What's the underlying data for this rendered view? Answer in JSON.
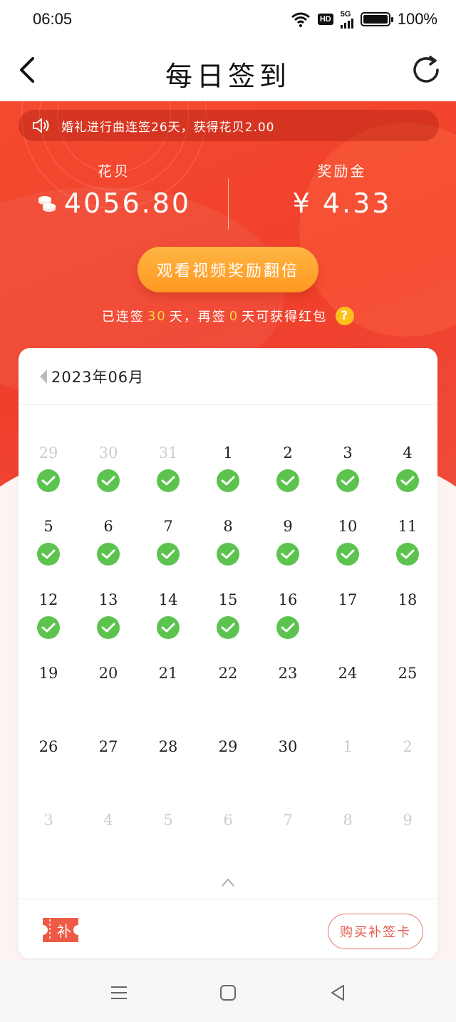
{
  "status_bar": {
    "time": "06:05",
    "hd": "HD",
    "network": "5G",
    "battery": "100%"
  },
  "header": {
    "title": "每日签到"
  },
  "notice": {
    "text": "婚礼进行曲连签26天，获得花贝2.00"
  },
  "stats": {
    "huabei_label": "花贝",
    "huabei_value": "4056.80",
    "reward_label": "奖励金",
    "reward_value": "¥ 4.33"
  },
  "video_button": {
    "label": "观看视频奖励翻倍"
  },
  "streak": {
    "prefix": "已连签",
    "days": "30",
    "mid": "天，再签",
    "remaining": "0",
    "suffix": "天可获得红包",
    "help": "?"
  },
  "calendar": {
    "month_label": "2023年06月",
    "days": [
      {
        "n": "29",
        "muted": true,
        "checked": true
      },
      {
        "n": "30",
        "muted": true,
        "checked": true
      },
      {
        "n": "31",
        "muted": true,
        "checked": true
      },
      {
        "n": "1",
        "muted": false,
        "checked": true
      },
      {
        "n": "2",
        "muted": false,
        "checked": true
      },
      {
        "n": "3",
        "muted": false,
        "checked": true
      },
      {
        "n": "4",
        "muted": false,
        "checked": true
      },
      {
        "n": "5",
        "muted": false,
        "checked": true
      },
      {
        "n": "6",
        "muted": false,
        "checked": true
      },
      {
        "n": "7",
        "muted": false,
        "checked": true
      },
      {
        "n": "8",
        "muted": false,
        "checked": true
      },
      {
        "n": "9",
        "muted": false,
        "checked": true
      },
      {
        "n": "10",
        "muted": false,
        "checked": true
      },
      {
        "n": "11",
        "muted": false,
        "checked": true
      },
      {
        "n": "12",
        "muted": false,
        "checked": true
      },
      {
        "n": "13",
        "muted": false,
        "checked": true
      },
      {
        "n": "14",
        "muted": false,
        "checked": true
      },
      {
        "n": "15",
        "muted": false,
        "checked": true
      },
      {
        "n": "16",
        "muted": false,
        "checked": true
      },
      {
        "n": "17",
        "muted": false,
        "checked": false
      },
      {
        "n": "18",
        "muted": false,
        "checked": false
      },
      {
        "n": "19",
        "muted": false,
        "checked": false
      },
      {
        "n": "20",
        "muted": false,
        "checked": false
      },
      {
        "n": "21",
        "muted": false,
        "checked": false
      },
      {
        "n": "22",
        "muted": false,
        "checked": false
      },
      {
        "n": "23",
        "muted": false,
        "checked": false
      },
      {
        "n": "24",
        "muted": false,
        "checked": false
      },
      {
        "n": "25",
        "muted": false,
        "checked": false
      },
      {
        "n": "26",
        "muted": false,
        "checked": false
      },
      {
        "n": "27",
        "muted": false,
        "checked": false
      },
      {
        "n": "28",
        "muted": false,
        "checked": false
      },
      {
        "n": "29",
        "muted": false,
        "checked": false
      },
      {
        "n": "30",
        "muted": false,
        "checked": false
      },
      {
        "n": "1",
        "muted": true,
        "checked": false
      },
      {
        "n": "2",
        "muted": true,
        "checked": false
      },
      {
        "n": "3",
        "muted": true,
        "checked": false
      },
      {
        "n": "4",
        "muted": true,
        "checked": false
      },
      {
        "n": "5",
        "muted": true,
        "checked": false
      },
      {
        "n": "6",
        "muted": true,
        "checked": false
      },
      {
        "n": "7",
        "muted": true,
        "checked": false
      },
      {
        "n": "8",
        "muted": true,
        "checked": false
      },
      {
        "n": "9",
        "muted": true,
        "checked": false
      }
    ]
  },
  "footer": {
    "bu_icon_text": "补",
    "buy_card_label": "购买补签卡"
  },
  "colors": {
    "accent": "#f0402c",
    "check": "#5dc34f",
    "button": "#ff9822",
    "highlight": "#ffd23f"
  },
  "icons": {
    "back": "chevron-left-icon",
    "refresh": "refresh-icon",
    "speaker": "speaker-icon",
    "coin": "coin-stack-icon",
    "check": "check-circle-icon",
    "chevron_up": "chevron-up-icon"
  }
}
